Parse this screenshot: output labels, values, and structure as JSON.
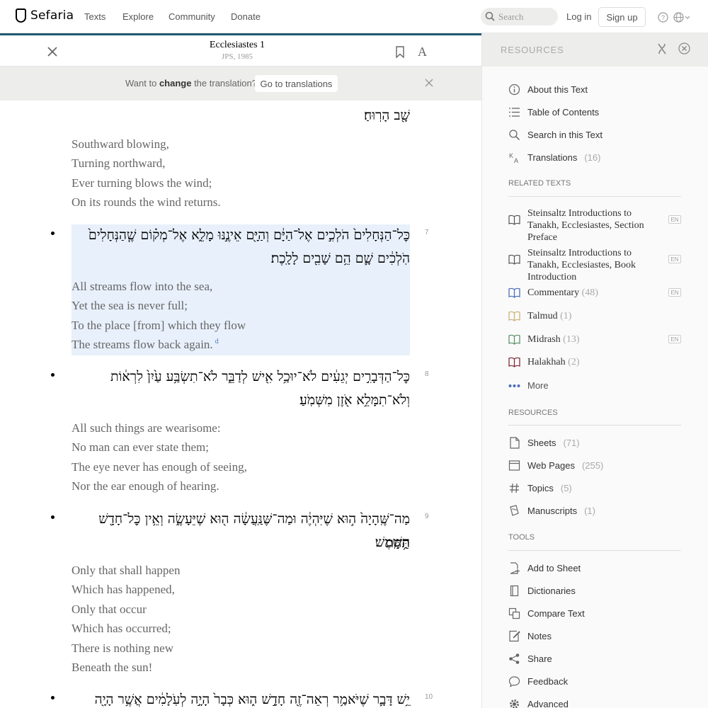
{
  "nav": {
    "logo": "Sefaria",
    "links": [
      "Texts",
      "Explore",
      "Community",
      "Donate"
    ],
    "search_placeholder": "Search",
    "login": "Log in",
    "signup": "Sign up"
  },
  "reader": {
    "title": "Ecclesiastes 1",
    "version": "JPS, 1985",
    "banner_prefix": "Want to ",
    "banner_bold": "change",
    "banner_suffix": " the translation?",
    "banner_button": "Go to translations"
  },
  "segments": [
    {
      "num": "",
      "he": [
        "שָׁ֖ב הָרֽוּחַ׃"
      ],
      "en": [
        "Southward blowing,",
        "Turning northward,",
        "Ever turning blows the wind;",
        "On its rounds the wind returns."
      ]
    },
    {
      "num": "7",
      "he": [
        "כׇּל־הַנְּחָלִים֙ הֹלְכִ֣ים אֶל־הַיָּ֔ם וְהַיָּ֖ם אֵינֶ֣נּוּ מָלֵ֑א אֶל־מְק֗וֹם שֶׁ֤הַנְּחָלִים֙",
        "הֹֽלְכִ֔ים שָׁ֛ם הֵ֥ם שָׁבִ֖ים לָלָֽכֶת׃"
      ],
      "en": [
        "All streams flow into the sea,",
        "Yet the sea is never full;",
        "To the place [from] which they flow",
        "The streams flow back again."
      ],
      "footnote": "d"
    },
    {
      "num": "8",
      "he": [
        "כׇּל־הַדְּבָרִ֣ים יְגֵעִ֔ים לֹא־יוּכַ֥ל אִ֖ישׁ לְדַבֵּ֑ר לֹא־תִשְׂבַּ֥ע עַ֙יִן֙ לִרְא֔וֹת",
        "וְלֹא־תִמָּלֵ֥א אֹ֖זֶן מִשְּׁמֹֽעַ׃"
      ],
      "en": [
        "All such things are wearisome:",
        "No man can ever state them;",
        "The eye never has enough of seeing,",
        "Nor the ear enough of hearing."
      ]
    },
    {
      "num": "9",
      "he": [
        "מַה־שֶּֽׁהָיָה֙ ה֣וּא שֶׁיִּהְיֶ֔ה וּמַה־שֶּׁנַּֽעֲשָׂ֔ה ה֖וּא שֶׁיֵּעָשֶׂ֑ה וְאֵ֥ין כׇּל־חָדָ֖שׁ תַּ֥חַת",
        "הַשָּֽׁמֶשׁ׃"
      ],
      "en": [
        "Only that shall happen",
        "Which has happened,",
        "Only that occur",
        "Which has occurred;",
        "There is nothing new",
        "Beneath the sun!"
      ]
    },
    {
      "num": "10",
      "he": [
        "יֵ֥שׁ דָּבָ֛ר שֶׁיֹּאמַ֥ר רְאֵה־זֶ֖ה חָדָ֣שׁ ה֑וּא כְּבָר֙ הָיָ֣ה לְעֹֽלָמִ֔ים אֲשֶׁ֥ר הָיָ֖ה"
      ],
      "en": []
    }
  ],
  "sidebar": {
    "title": "RESOURCES",
    "top_items": [
      {
        "icon": "info-icon",
        "label": "About this Text",
        "count": ""
      },
      {
        "icon": "list-icon",
        "label": "Table of Contents",
        "count": ""
      },
      {
        "icon": "search-icon",
        "label": "Search in this Text",
        "count": ""
      },
      {
        "icon": "translate-icon",
        "label": "Translations",
        "count": "(16)"
      }
    ],
    "related_heading": "RELATED TEXTS",
    "related": [
      {
        "label": "Steinsaltz Introductions to Tanakh, Ecclesiastes, Section Preface",
        "count": "",
        "badge": "EN",
        "color": "#555"
      },
      {
        "label": "Steinsaltz Introductions to Tanakh, Ecclesiastes, Book Introduction",
        "count": "",
        "badge": "EN",
        "color": "#555"
      },
      {
        "label": "Commentary",
        "count": "(48)",
        "badge": "EN",
        "color": "#4b71b7"
      },
      {
        "label": "Talmud",
        "count": "(1)",
        "badge": "",
        "color": "#ccb479"
      },
      {
        "label": "Midrash",
        "count": "(13)",
        "badge": "EN",
        "color": "#5d956f"
      },
      {
        "label": "Halakhah",
        "count": "(2)",
        "badge": "",
        "color": "#802f3e"
      }
    ],
    "more": "More",
    "resources_heading": "RESOURCES",
    "resources": [
      {
        "icon": "sheet-icon",
        "label": "Sheets",
        "count": "(71)"
      },
      {
        "icon": "webpage-icon",
        "label": "Web Pages",
        "count": "(255)"
      },
      {
        "icon": "hashtag-icon",
        "label": "Topics",
        "count": "(5)"
      },
      {
        "icon": "manuscript-icon",
        "label": "Manuscripts",
        "count": "(1)"
      }
    ],
    "tools_heading": "TOOLS",
    "tools": [
      {
        "icon": "add-sheet-icon",
        "label": "Add to Sheet"
      },
      {
        "icon": "dictionary-icon",
        "label": "Dictionaries"
      },
      {
        "icon": "compare-icon",
        "label": "Compare Text"
      },
      {
        "icon": "notes-icon",
        "label": "Notes"
      },
      {
        "icon": "share-icon",
        "label": "Share"
      },
      {
        "icon": "feedback-icon",
        "label": "Feedback"
      },
      {
        "icon": "gear-icon",
        "label": "Advanced"
      }
    ]
  }
}
